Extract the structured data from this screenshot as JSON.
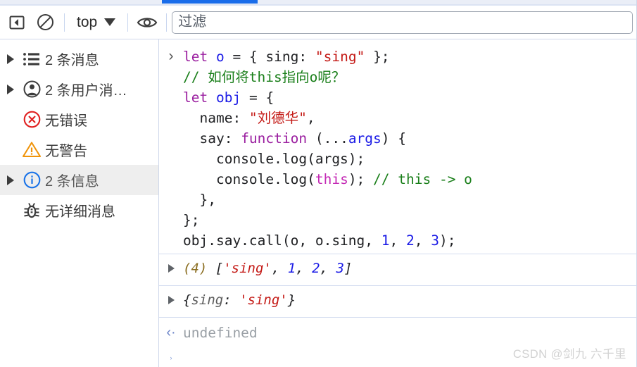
{
  "window": {
    "title": "DevTools Console",
    "accent_color": "#1a6dea",
    "tabstrip_bg": "#eaeef7",
    "border_color": "#cfd8ea"
  },
  "toolbar": {
    "sidebar_toggle_icon": "sidebar-toggle-icon",
    "clear_console_icon": "clear-console-icon",
    "context_selector": {
      "value": "top",
      "caret_icon": "chevron-down-icon"
    },
    "eye_icon": "eye-icon",
    "filter": {
      "value": "",
      "placeholder": "过滤"
    }
  },
  "sidebar": {
    "items": [
      {
        "label": "2 条消息",
        "icon": "list-icon",
        "has_twisty": true,
        "selected": false,
        "icon_color": "#3c3c3c"
      },
      {
        "label": "2 条用户消…",
        "icon": "user-icon",
        "has_twisty": true,
        "selected": false,
        "icon_color": "#3c3c3c"
      },
      {
        "label": "无错误",
        "icon": "error-icon",
        "has_twisty": false,
        "selected": false,
        "icon_color": "#e02020"
      },
      {
        "label": "无警告",
        "icon": "warning-icon",
        "has_twisty": false,
        "selected": false,
        "icon_color": "#f0940a"
      },
      {
        "label": "2 条信息",
        "icon": "info-icon",
        "has_twisty": true,
        "selected": true,
        "icon_color": "#1a73e8"
      },
      {
        "label": "无详细消息",
        "icon": "bug-icon",
        "has_twisty": false,
        "selected": false,
        "icon_color": "#3c3c3c"
      }
    ]
  },
  "console": {
    "prompt_chevron": "›",
    "return_chevron": "‹·",
    "code_lines": [
      [
        {
          "t": "let",
          "c": "kw"
        },
        {
          "t": " ",
          "c": "plain"
        },
        {
          "t": "o",
          "c": "var"
        },
        {
          "t": " = { sing: ",
          "c": "plain"
        },
        {
          "t": "\"sing\"",
          "c": "str"
        },
        {
          "t": " };",
          "c": "plain"
        }
      ],
      [
        {
          "t": "// 如何将this指向o呢？",
          "c": "cmt"
        }
      ],
      [
        {
          "t": "let",
          "c": "kw"
        },
        {
          "t": " ",
          "c": "plain"
        },
        {
          "t": "obj",
          "c": "var"
        },
        {
          "t": " = {",
          "c": "plain"
        }
      ],
      [
        {
          "t": "  name: ",
          "c": "plain"
        },
        {
          "t": "\"刘德华\"",
          "c": "str"
        },
        {
          "t": ",",
          "c": "plain"
        }
      ],
      [
        {
          "t": "  say: ",
          "c": "plain"
        },
        {
          "t": "function",
          "c": "kw"
        },
        {
          "t": " (...",
          "c": "plain"
        },
        {
          "t": "args",
          "c": "var"
        },
        {
          "t": ") {",
          "c": "plain"
        }
      ],
      [
        {
          "t": "    console.log(args);",
          "c": "plain"
        }
      ],
      [
        {
          "t": "    console.log(",
          "c": "plain"
        },
        {
          "t": "this",
          "c": "this"
        },
        {
          "t": "); ",
          "c": "plain"
        },
        {
          "t": "// this -> o",
          "c": "cmt"
        }
      ],
      [
        {
          "t": "  },",
          "c": "plain"
        }
      ],
      [
        {
          "t": "};",
          "c": "plain"
        }
      ],
      [
        {
          "t": "obj.say.call(o, o.sing, ",
          "c": "plain"
        },
        {
          "t": "1",
          "c": "num"
        },
        {
          "t": ", ",
          "c": "plain"
        },
        {
          "t": "2",
          "c": "num"
        },
        {
          "t": ", ",
          "c": "plain"
        },
        {
          "t": "3",
          "c": "num"
        },
        {
          "t": ");",
          "c": "plain"
        }
      ]
    ],
    "results": [
      {
        "expandable": true,
        "parts": [
          {
            "t": "(4) ",
            "c": "count"
          },
          {
            "t": "[",
            "c": "brk"
          },
          {
            "t": "'sing'",
            "c": "str"
          },
          {
            "t": ", ",
            "c": "brk"
          },
          {
            "t": "1",
            "c": "num"
          },
          {
            "t": ", ",
            "c": "brk"
          },
          {
            "t": "2",
            "c": "num"
          },
          {
            "t": ", ",
            "c": "brk"
          },
          {
            "t": "3",
            "c": "num"
          },
          {
            "t": "]",
            "c": "brk"
          }
        ]
      },
      {
        "expandable": true,
        "parts": [
          {
            "t": "{",
            "c": "brk"
          },
          {
            "t": "sing",
            "c": "key"
          },
          {
            "t": ": ",
            "c": "brk"
          },
          {
            "t": "'sing'",
            "c": "str"
          },
          {
            "t": "}",
            "c": "brk"
          }
        ]
      }
    ],
    "return_value": "undefined"
  },
  "watermark": {
    "text": "CSDN @剑九 六千里"
  }
}
